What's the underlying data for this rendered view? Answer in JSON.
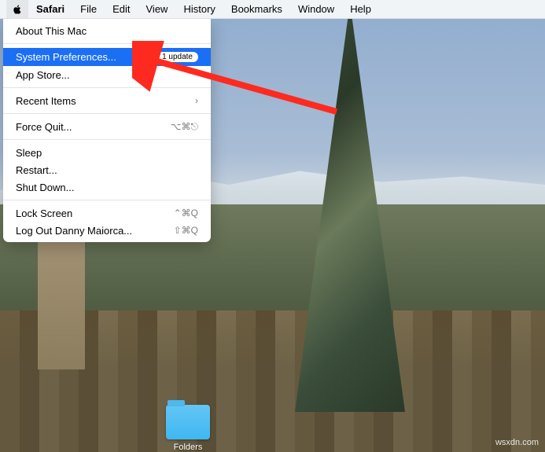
{
  "menubar": {
    "app": "Safari",
    "items": [
      "File",
      "Edit",
      "View",
      "History",
      "Bookmarks",
      "Window",
      "Help"
    ]
  },
  "apple_menu": {
    "about": "About This Mac",
    "system_prefs": "System Preferences...",
    "system_prefs_badge": "1 update",
    "app_store": "App Store...",
    "recent_items": "Recent Items",
    "force_quit": "Force Quit...",
    "force_quit_keys": "⌥⌘⎋",
    "sleep": "Sleep",
    "restart": "Restart...",
    "shut_down": "Shut Down...",
    "lock_screen": "Lock Screen",
    "lock_screen_keys": "⌃⌘Q",
    "log_out": "Log Out Danny Maiorca...",
    "log_out_keys": "⇧⌘Q"
  },
  "desktop": {
    "folder_label": "Folders"
  },
  "watermark": "wsxdn.com"
}
